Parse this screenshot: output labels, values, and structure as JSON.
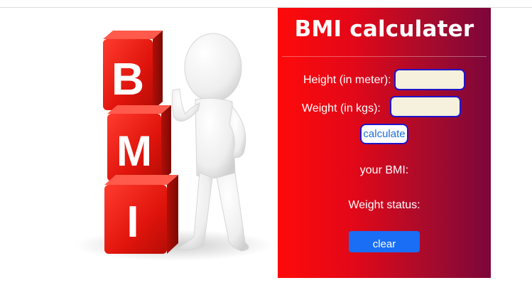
{
  "hero": {
    "cube_letters": [
      "B",
      "M",
      "I"
    ]
  },
  "panel": {
    "title": "BMI calculater",
    "height_label": "Height (in meter):",
    "height_value": "",
    "weight_label": "Weight (in kgs):",
    "weight_value": "",
    "calculate_label": "calculate",
    "bmi_label": "your BMI:",
    "status_label": "Weight status:",
    "clear_label": "clear"
  },
  "colors": {
    "panel_gradient_start": "#fe0a0a",
    "panel_gradient_end": "#7c063a",
    "input_background": "#f5f1dc",
    "input_border": "#1f14c9",
    "calculate_text": "#1a6fd9",
    "clear_button": "#1a6ef5",
    "cube_red": "#e31b12"
  }
}
